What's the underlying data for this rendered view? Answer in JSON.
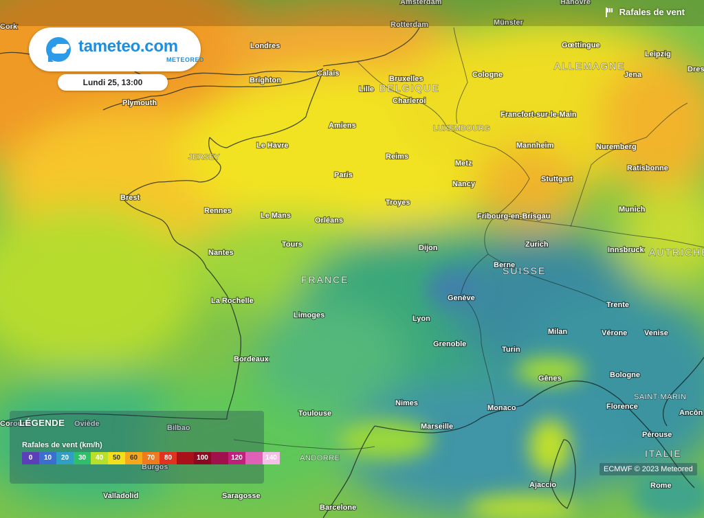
{
  "header": {
    "layer_title": "Rafales de vent",
    "layer_icon": "windsock-icon"
  },
  "logo": {
    "name": "tameteo.com",
    "sub": "METEORED"
  },
  "date_label": "Lundi 25, 13:00",
  "legend": {
    "title": "LÉGENDE",
    "subtitle": "Rafales de vent (km/h)",
    "scale": [
      {
        "label": "0",
        "color": "#5a3fb8"
      },
      {
        "label": "10",
        "color": "#3a6ecf"
      },
      {
        "label": "20",
        "color": "#2f9fc4"
      },
      {
        "label": "30",
        "color": "#2fbf6a"
      },
      {
        "label": "40",
        "color": "#b8e02a"
      },
      {
        "label": "50",
        "color": "#f3e01a"
      },
      {
        "label": "60",
        "color": "#f6a81c"
      },
      {
        "label": "70",
        "color": "#f07a1e"
      },
      {
        "label": "80",
        "color": "#e0321e"
      },
      {
        "label": "",
        "color": "#a8101a"
      },
      {
        "label": "100",
        "color": "#8a0a22"
      },
      {
        "label": "",
        "color": "#a0104a"
      },
      {
        "label": "120",
        "color": "#c0207a"
      },
      {
        "label": "",
        "color": "#e060b8"
      },
      {
        "label": "140",
        "color": "#f4c0e8"
      }
    ]
  },
  "credit": "ECMWF © 2023 Meteored",
  "cities": [
    "Amsterdam",
    "Hanovre",
    "Rotterdam",
    "Münster",
    "Cork",
    "Londres",
    "Gœttingue",
    "Leipzig",
    "Dres",
    "Calais",
    "Bruxelles",
    "Cologne",
    "Brighton",
    "Lille",
    "Charleroi",
    "Jena",
    "Plymouth",
    "Amiens",
    "Francfort-sur-le-Main",
    "Le Havre",
    "Mannheim",
    "Nuremberg",
    "Reims",
    "Metz",
    "Ratisbonne",
    "Paris",
    "Stuttgart",
    "Nancy",
    "Brest",
    "Troyes",
    "Munich",
    "Rennes",
    "Le Mans",
    "Orléans",
    "Fribourg-en-Brisgau",
    "Zurich",
    "Innsbruck",
    "Tours",
    "Nantes",
    "Dijon",
    "Berne",
    "La Rochelle",
    "Genève",
    "Trente",
    "Limoges",
    "Lyon",
    "Milan",
    "Vérone",
    "Venise",
    "Grenoble",
    "Turin",
    "Bordeaux",
    "Gênes",
    "Bologne",
    "Nimes",
    "Monaco",
    "Florence",
    "Toulouse",
    "Ancôn",
    "Coroune",
    "Oviède",
    "Marseille",
    "Bilbao",
    "Pérouse",
    "Burgos",
    "Valladolid",
    "Saragosse",
    "Ajaccio",
    "Rome",
    "Barcelone"
  ],
  "countries": [
    "ALLEMAGNE",
    "BELGIQUE",
    "LUXEMBOURG",
    "JERSEY",
    "FRANCE",
    "SUISSE",
    "AUTRICHE",
    "SAINT-MARIN",
    "ANDORRE",
    "ITALIE"
  ]
}
